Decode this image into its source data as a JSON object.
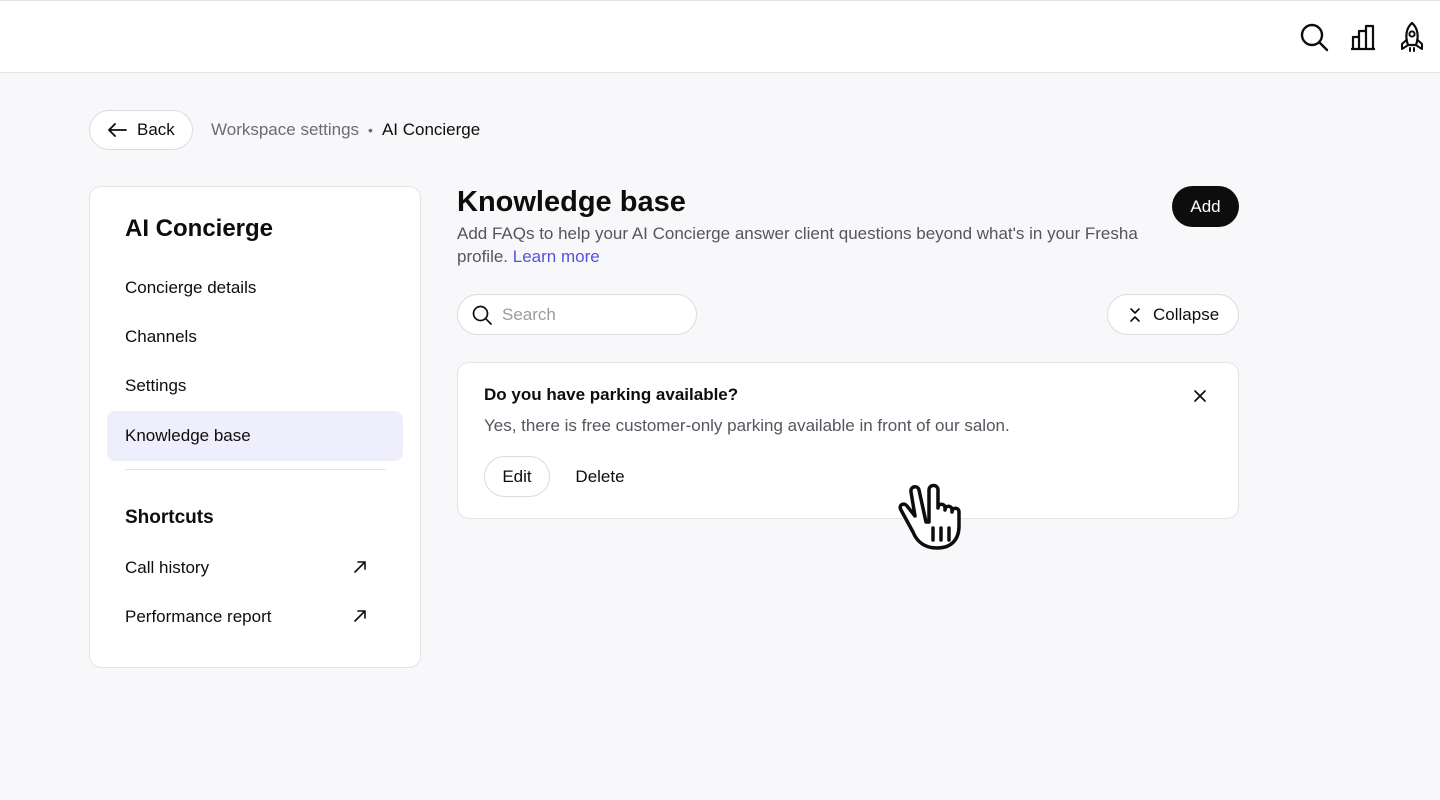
{
  "topbar": {
    "icons": [
      "search-icon",
      "chart-icon",
      "rocket-icon"
    ]
  },
  "nav": {
    "back_label": "Back",
    "breadcrumb": {
      "parent": "Workspace settings",
      "separator": "•",
      "current": "AI Concierge"
    }
  },
  "sidebar": {
    "title": "AI Concierge",
    "items": [
      {
        "label": "Concierge details",
        "active": false
      },
      {
        "label": "Channels",
        "active": false
      },
      {
        "label": "Settings",
        "active": false
      },
      {
        "label": "Knowledge base",
        "active": true
      }
    ],
    "shortcuts_title": "Shortcuts",
    "shortcuts": [
      {
        "label": "Call history",
        "icon": "external-link-icon"
      },
      {
        "label": "Performance report",
        "icon": "external-link-icon"
      }
    ]
  },
  "main": {
    "title": "Knowledge base",
    "description": "Add FAQs to help your AI Concierge answer client questions beyond what's in your Fresha profile.",
    "learn_more": "Learn more",
    "add_label": "Add",
    "search_placeholder": "Search",
    "collapse_label": "Collapse",
    "faqs": [
      {
        "question": "Do you have parking available?",
        "answer": "Yes, there is free customer-only parking available in front of our salon.",
        "edit_label": "Edit",
        "delete_label": "Delete"
      }
    ]
  },
  "colors": {
    "accent": "#5450e5",
    "active_item_bg": "#eeeefc",
    "primary_button": "#0d0d0d",
    "page_bg": "#f8f8fa"
  }
}
